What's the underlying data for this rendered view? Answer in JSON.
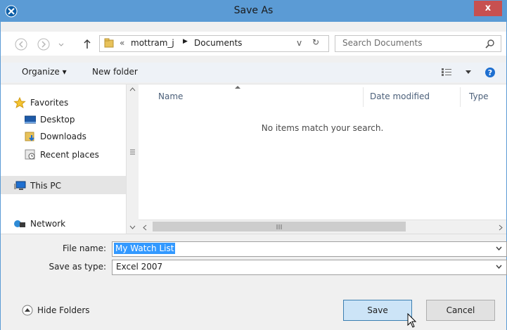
{
  "dialog": {
    "title": "Save As"
  },
  "titlebar": {
    "close_label": "x"
  },
  "address": {
    "prefix": "«",
    "crumbs": [
      "mottram_j",
      "Documents"
    ],
    "refresh_glyph": "↻",
    "dropdown_glyph": "v"
  },
  "search": {
    "placeholder": "Search Documents",
    "icon": "search-icon"
  },
  "toolbar": {
    "organize": "Organize ▾",
    "new_folder": "New folder"
  },
  "nav": {
    "favorites": "Favorites",
    "desktop": "Desktop",
    "downloads": "Downloads",
    "recent": "Recent places",
    "this_pc": "This PC",
    "network": "Network"
  },
  "file_list": {
    "columns": [
      "Name",
      "Date modified",
      "Type"
    ],
    "empty_message": "No items match your search."
  },
  "form": {
    "file_name_label": "File name:",
    "file_name_value": "My Watch List",
    "save_type_label": "Save as type:",
    "save_type_value": "Excel 2007"
  },
  "buttons": {
    "hide_folders": "Hide Folders",
    "save": "Save",
    "cancel": "Cancel"
  },
  "colors": {
    "accent": "#5b9bd5",
    "selection": "#3399ff"
  }
}
